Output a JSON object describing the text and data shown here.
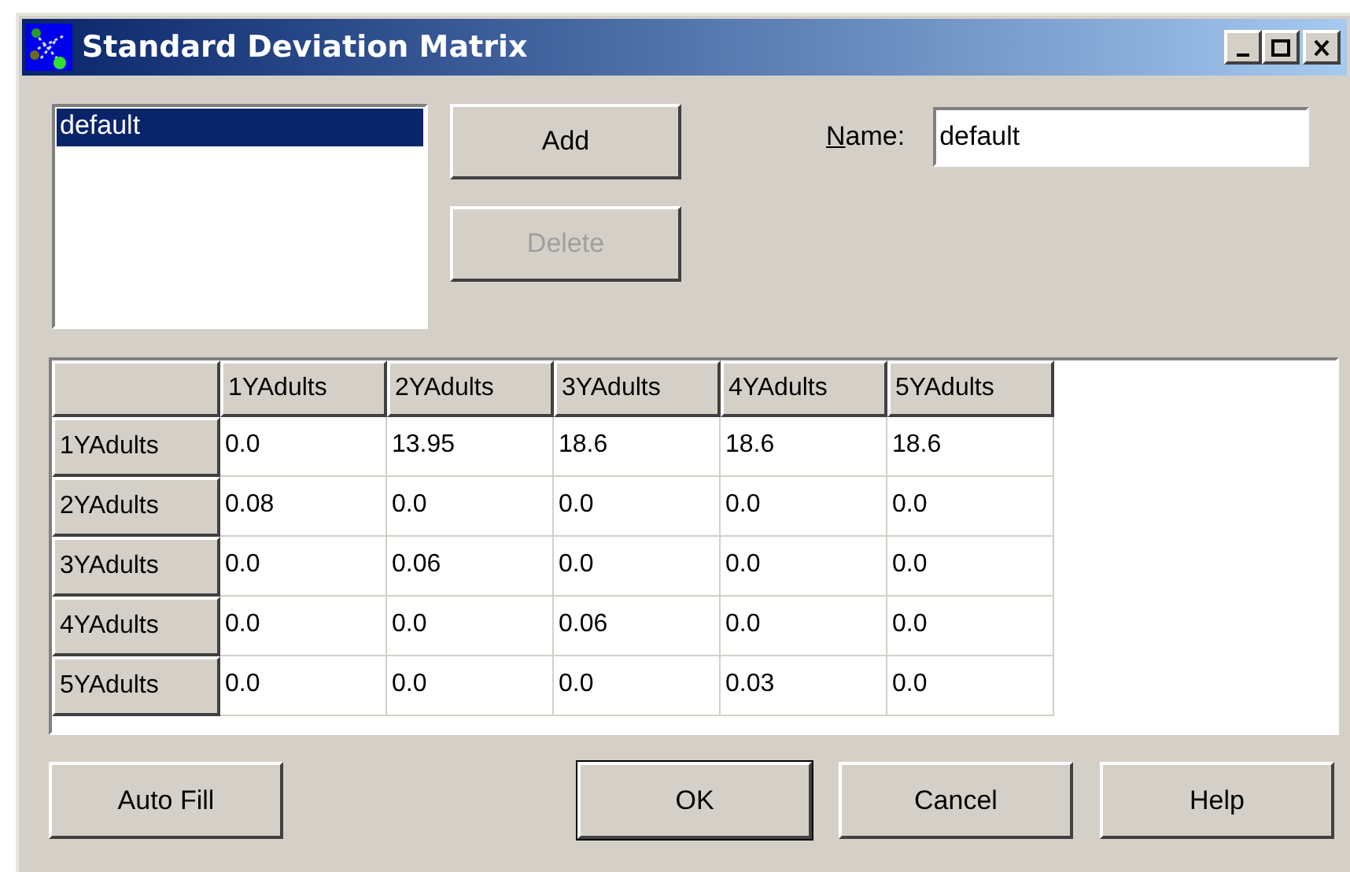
{
  "window": {
    "title": "Standard Deviation Matrix",
    "controls": [
      {
        "kind": "minimize"
      },
      {
        "kind": "maximize"
      },
      {
        "kind": "close"
      }
    ]
  },
  "list": {
    "items": [
      {
        "label": "default",
        "selected": true
      }
    ]
  },
  "side_buttons": [
    {
      "label": "Add",
      "disabled": false
    },
    {
      "label": "Delete",
      "disabled": true
    }
  ],
  "name_field": {
    "label": "Name:",
    "value": "default"
  },
  "matrix": {
    "columns": [
      "1YAdults",
      "2YAdults",
      "3YAdults",
      "4YAdults",
      "5YAdults"
    ],
    "rows": [
      {
        "header": "1YAdults",
        "cells": [
          "0.0",
          "13.95",
          "18.6",
          "18.6",
          "18.6"
        ]
      },
      {
        "header": "2YAdults",
        "cells": [
          "0.08",
          "0.0",
          "0.0",
          "0.0",
          "0.0"
        ]
      },
      {
        "header": "3YAdults",
        "cells": [
          "0.0",
          "0.06",
          "0.0",
          "0.0",
          "0.0"
        ]
      },
      {
        "header": "4YAdults",
        "cells": [
          "0.0",
          "0.0",
          "0.06",
          "0.0",
          "0.0"
        ]
      },
      {
        "header": "5YAdults",
        "cells": [
          "0.0",
          "0.0",
          "0.0",
          "0.03",
          "0.0"
        ]
      }
    ]
  },
  "buttons": [
    {
      "label": "Auto Fill",
      "default": false
    },
    {
      "label": "OK",
      "default": true
    },
    {
      "label": "Cancel",
      "default": false
    },
    {
      "label": "Help",
      "default": false
    }
  ]
}
